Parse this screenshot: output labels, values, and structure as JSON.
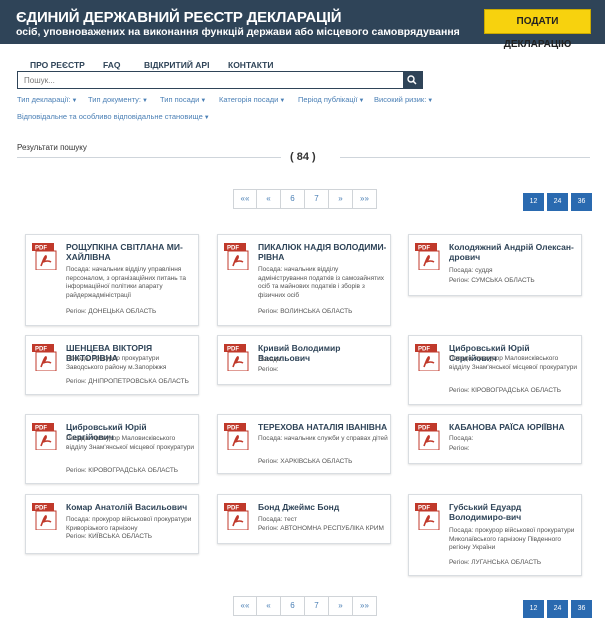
{
  "header": {
    "title": "ЄДИНИЙ ДЕРЖАВНИЙ РЕЄСТР ДЕКЛАРАЦІЙ",
    "subtitle": "осіб, уповноважених на виконання функцій держави або місцевого самоврядування",
    "submit_label": "ПОДАТИ ДЕКЛАРАЦІЮ"
  },
  "nav": [
    "ПРО РЕЄСТР",
    "FAQ",
    "ВІДКРИТИЙ API",
    "КОНТАКТИ"
  ],
  "search": {
    "placeholder": "Пошук...",
    "value": ""
  },
  "filters": [
    "Тип декларації:",
    "Тип документу:",
    "Тип посади",
    "Категорія посади",
    "Період публікації",
    "Високий ризик:",
    "Відповідальне та особливо відповідальне становище"
  ],
  "results": {
    "label": "Результати пошуку",
    "count": "( 84 )"
  },
  "pagination": [
    "««",
    "«",
    "6",
    "7",
    "»",
    "»»"
  ],
  "page_sizes": [
    "12",
    "24",
    "36"
  ],
  "cards": [
    {
      "name": "РОЩУПКІНА СВІТЛАНА МИ-ХАЙЛІВНА",
      "position": "Посада: начальник відділу управління персоналом, з організаційних питань та інформаційної політики апарату райдержадміністрації",
      "region": "Регіон: ДОНЕЦЬКА ОБЛАСТЬ"
    },
    {
      "name": "ПИКАЛЮК НАДІЯ ВОЛОДИМИ-РІВНА",
      "position": "Посада: начальник відділу адміністрування податків із самозайнятих осіб та майнових податків і зборів з фізичних осіб",
      "region": "Регіон: ВОЛИНСЬКА ОБЛАСТЬ"
    },
    {
      "name": "Колодяжний Андрій Олексан-дрович",
      "position": "Посада: суддя",
      "region": "Регіон: СУМСЬКА ОБЛАСТЬ"
    },
    {
      "name": "ШЕНЦЕВА ВІКТОРІЯ ВІКТОРІВНА",
      "position": "Посада: прокурор прокуратури Заводського району м.Запоріжжя",
      "region": "Регіон: ДНІПРОПЕТРОВСЬКА ОБЛАСТЬ"
    },
    {
      "name": "Кривий Володимир Васильович",
      "position": "Посада:",
      "region": "Регіон:"
    },
    {
      "name": "Цибровський Юрій Сергійович",
      "position": "Посада: прокурор Маловисківського відділу Знам'янської місцевої прокуратури",
      "region": "Регіон: КІРОВОГРАДСЬКА ОБЛАСТЬ"
    },
    {
      "name": "Цибровський Юрій Сергійович",
      "position": "Посада: прокурор Маловисківського відділу Знам'янської місцевої прокуратури",
      "region": "Регіон: КІРОВОГРАДСЬКА ОБЛАСТЬ"
    },
    {
      "name": "ТЕРЕХОВА НАТАЛІЯ ІВАНІВНА",
      "position": "Посада: начальник служби у справах дітей",
      "region": "Регіон: ХАРКІВСЬКА ОБЛАСТЬ"
    },
    {
      "name": "КАБАНОВА РАЇСА ЮРІЇВНА",
      "position": "Посада:",
      "region": "Регіон:"
    },
    {
      "name": "Комар Анатолій Васильович",
      "position": "Посада: прокурор військової прокуратури Криворізького гарнізону",
      "region": "Регіон: КИЇВСЬКА ОБЛАСТЬ"
    },
    {
      "name": "Бонд Джеймс Бонд",
      "position": "Посада: тест",
      "region": "Регіон: АВТОНОМНА РЕСПУБЛІКА КРИМ"
    },
    {
      "name": "Губський Едуард Володимиро-вич",
      "position": "Посада: прокурор військової прокуратури Миколаївського гарнізону Південного регіону України",
      "region": "Регіон: ЛУГАНСЬКА ОБЛАСТЬ"
    }
  ],
  "colors": {
    "header_bg": "#2f4458",
    "accent": "#f7d20e",
    "link": "#4a7fb5",
    "pdf_red": "#c0392b",
    "size_btn": "#2a6ab0"
  },
  "icons": {
    "search": "search-icon",
    "pdf": "pdf-icon",
    "caret": "caret-down-icon"
  }
}
